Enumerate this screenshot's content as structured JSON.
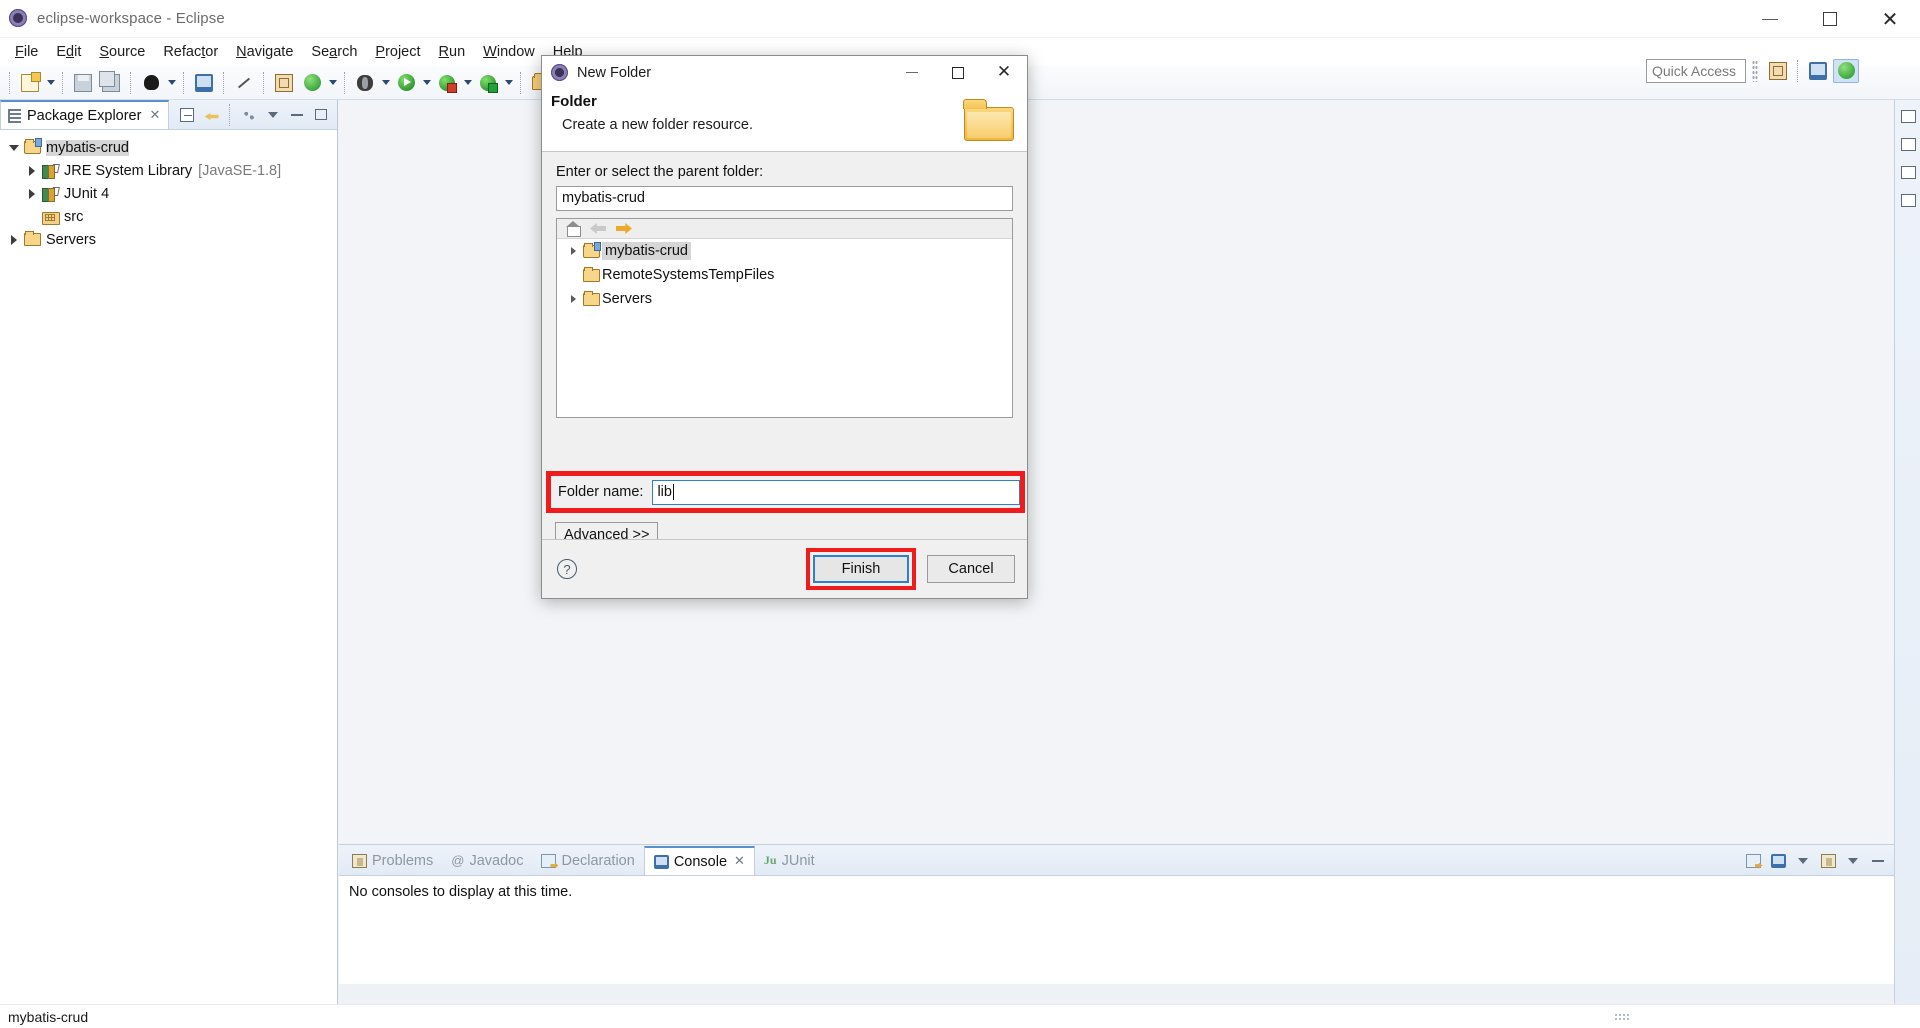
{
  "window": {
    "title": "eclipse-workspace - Eclipse",
    "minimize": "–",
    "maximize": "□",
    "close": "✕"
  },
  "menu": [
    {
      "label": "File"
    },
    {
      "label": "Edit"
    },
    {
      "label": "Source"
    },
    {
      "label": "Refactor"
    },
    {
      "label": "Navigate"
    },
    {
      "label": "Search"
    },
    {
      "label": "Project"
    },
    {
      "label": "Run"
    },
    {
      "label": "Window"
    },
    {
      "label": "Help"
    }
  ],
  "quick_access": {
    "placeholder": "Quick Access"
  },
  "package_explorer": {
    "tab_label": "Package Explorer",
    "tab_close": "✕",
    "tree": [
      {
        "label": "mybatis-crud",
        "suffix": "",
        "depth": 0,
        "state": "open",
        "icon": "project-icon",
        "selected": true
      },
      {
        "label": "JRE System Library",
        "suffix": "[JavaSE-1.8]",
        "depth": 1,
        "state": "closed",
        "icon": "library-icon",
        "selected": false
      },
      {
        "label": "JUnit 4",
        "suffix": "",
        "depth": 1,
        "state": "closed",
        "icon": "library-icon",
        "selected": false
      },
      {
        "label": "src",
        "suffix": "",
        "depth": 1,
        "state": "none",
        "icon": "source-folder-icon",
        "selected": false
      },
      {
        "label": "Servers",
        "suffix": "",
        "depth": 0,
        "state": "closed",
        "icon": "folder-icon",
        "selected": false
      }
    ]
  },
  "console_panel": {
    "tabs": [
      {
        "label": "Problems",
        "icon": "problems-icon",
        "active": false
      },
      {
        "label": "Javadoc",
        "icon": "javadoc-icon",
        "active": false
      },
      {
        "label": "Declaration",
        "icon": "declaration-icon",
        "active": false
      },
      {
        "label": "Console",
        "icon": "console-icon",
        "active": true,
        "close": "✕"
      },
      {
        "label": "JUnit",
        "icon": "junit-icon",
        "active": false
      }
    ],
    "message": "No consoles to display at this time."
  },
  "status_bar": {
    "text": "mybatis-crud"
  },
  "dialog": {
    "title": "New Folder",
    "minimize": "–",
    "maximize": "□",
    "close": "✕",
    "header_title": "Folder",
    "header_subtitle": "Create a new folder resource.",
    "parent_label": "Enter or select the parent folder:",
    "parent_value": "mybatis-crud",
    "tree_toolbar": [
      "home-icon",
      "back-icon",
      "forward-icon"
    ],
    "tree": [
      {
        "label": "mybatis-crud",
        "state": "closed",
        "icon": "project-icon",
        "selected": true
      },
      {
        "label": "RemoteSystemsTempFiles",
        "state": "none",
        "icon": "folder-icon",
        "selected": false
      },
      {
        "label": "Servers",
        "state": "closed",
        "icon": "folder-icon",
        "selected": false
      }
    ],
    "folder_name_label": "Folder name:",
    "folder_name_value": "lib",
    "advanced_label": "Advanced >>",
    "help_label": "?",
    "finish_label": "Finish",
    "cancel_label": "Cancel"
  },
  "colors": {
    "highlight_red": "#ee1c1c",
    "focus_blue": "#2f7fd0",
    "tab_accent": "#5a8fd0",
    "folder_yellow": "#f6cf7a"
  }
}
